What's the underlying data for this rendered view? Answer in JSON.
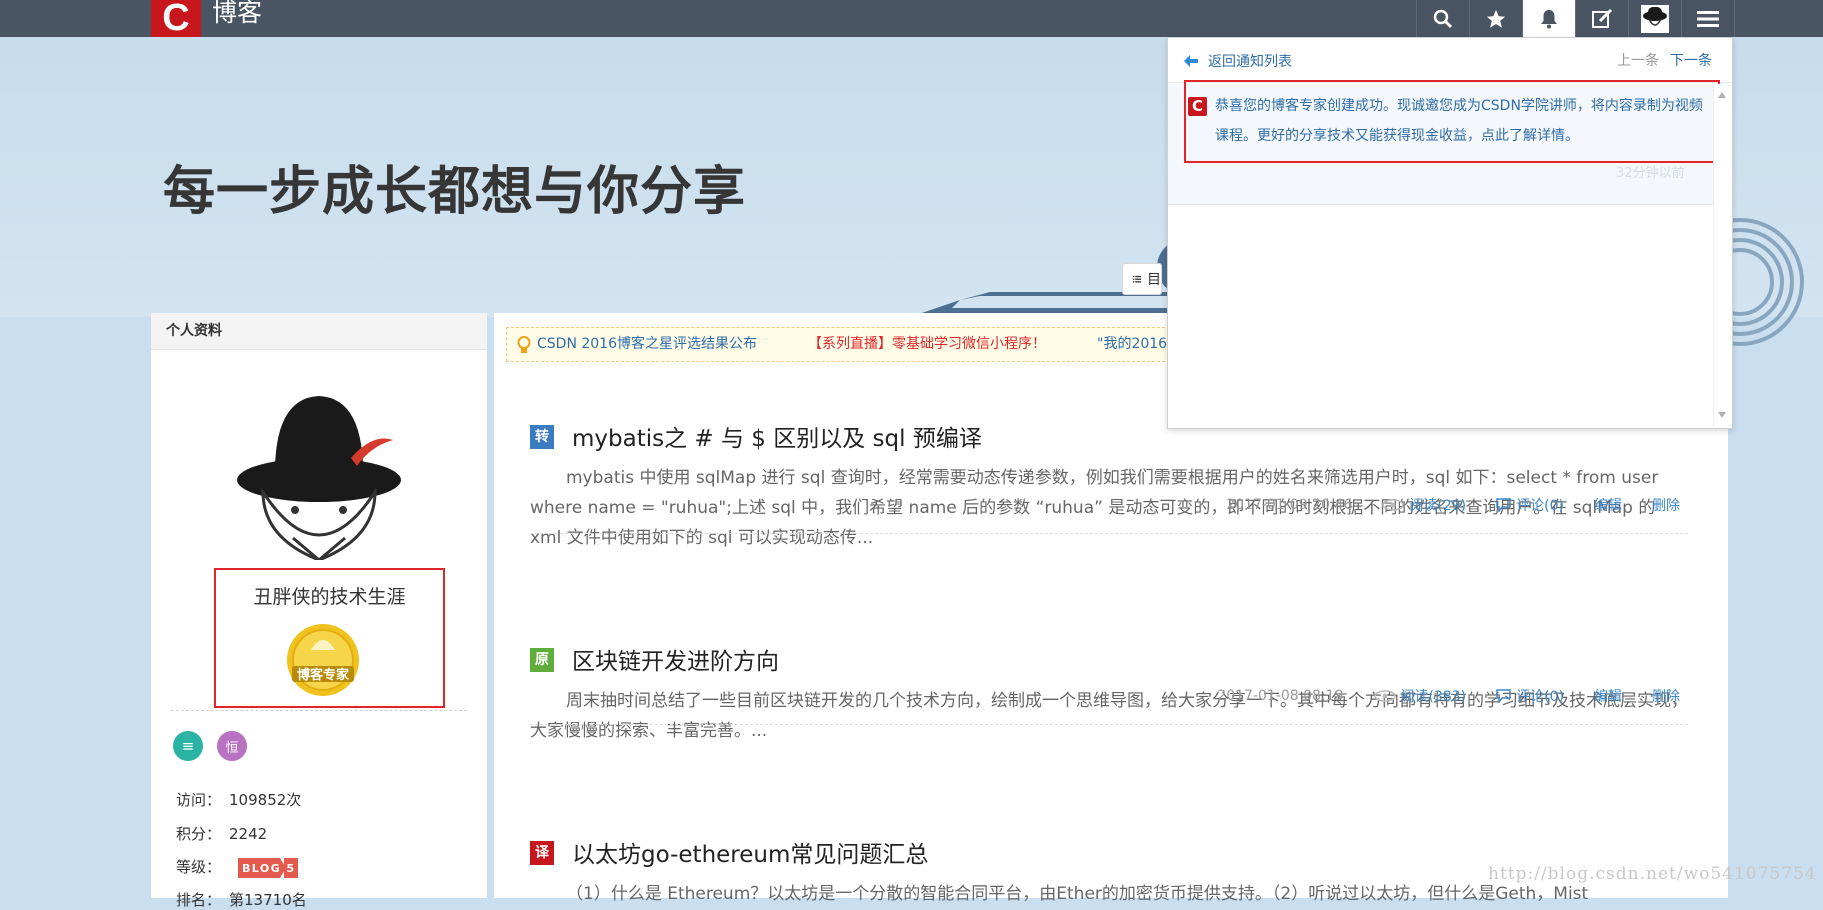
{
  "topbar": {
    "logo_letter": "C",
    "logo_text": "博客",
    "nav_icons": [
      "search-icon",
      "star-icon",
      "bell-icon",
      "edit-icon",
      "avatar",
      "menu-icon"
    ]
  },
  "banner": {
    "title": "每一步成长都想与你分享",
    "directory_label": "目"
  },
  "profile": {
    "header": "个人资料",
    "blog_name": "丑胖侠的技术生涯",
    "badge_text": "博客专家",
    "icon_1": "≡",
    "icon_2": "恒",
    "stats": [
      {
        "label": "访问：",
        "value": "109852次"
      },
      {
        "label": "积分：",
        "value": "2242"
      },
      {
        "label": "等级：",
        "value": ""
      },
      {
        "label": "排名：",
        "value": "第13710名"
      }
    ],
    "level_badge": "BLOG 5"
  },
  "notice_bar": {
    "item_1": "CSDN 2016博客之星评选结果公布",
    "item_2": "【系列直播】零基础学习微信小程序！",
    "item_3": "\"我的2016\""
  },
  "posts": [
    {
      "tag": "转",
      "tag_color": "#3b7bbf",
      "title": "mybatis之 # 与 $ 区别以及 sql 预编译",
      "summary": "mybatis 中使用 sqlMap 进行 sql 查询时，经常需要动态传递参数，例如我们需要根据用户的姓名来筛选用户时，sql 如下：select * from user where name = \"ruhua\";上述 sql 中，我们希望 name 后的参数 “ruhua” 是动态可变的，即不同的时刻根据不同的姓名来查询用户。在 sqlMap 的 xml 文件中使用如下的 sql 可以实现动态传...",
      "date": "2017-01-09 20:46",
      "reads": "阅读(29)",
      "comments": "评论(0)",
      "edit": "编辑",
      "delete": "删除"
    },
    {
      "tag": "原",
      "tag_color": "#5fae3b",
      "title": "区块链开发进阶方向",
      "summary": "周末抽时间总结了一些目前区块链开发的几个技术方向，绘制成一个思维导图，给大家分享一下。其中每个方向都有特有的学习细节及技术底层实现，大家慢慢的探索、丰富完善。...",
      "date": "2017-01-08 08:19",
      "reads": "阅读(383)",
      "comments": "评论(0)",
      "edit": "编辑",
      "delete": "删除"
    },
    {
      "tag": "译",
      "tag_color": "#c7161c",
      "title": "以太坊go-ethereum常见问题汇总",
      "summary": "（1）什么是 Ethereum？以太坊是一个分散的智能合同平台，由Ether的加密货币提供支持。（2）听说过以太坊，但什么是Geth，Mist"
    }
  ],
  "notification": {
    "back_label": "返回通知列表",
    "prev_label": "上一条",
    "next_label": "下一条",
    "message": "恭喜您的博客专家创建成功。现诚邀您成为CSDN学院讲师，将内容录制为视频课程。更好的分享技术又能获得现金收益，点此了解详情。",
    "time": "32分钟以前"
  },
  "watermark": "http://blog.csdn.net/wo541075754",
  "colors": {
    "topbar": "#4a5563",
    "brand_red": "#c7161c",
    "link_blue": "#3c87c9",
    "highlight_red": "#e0262b"
  }
}
